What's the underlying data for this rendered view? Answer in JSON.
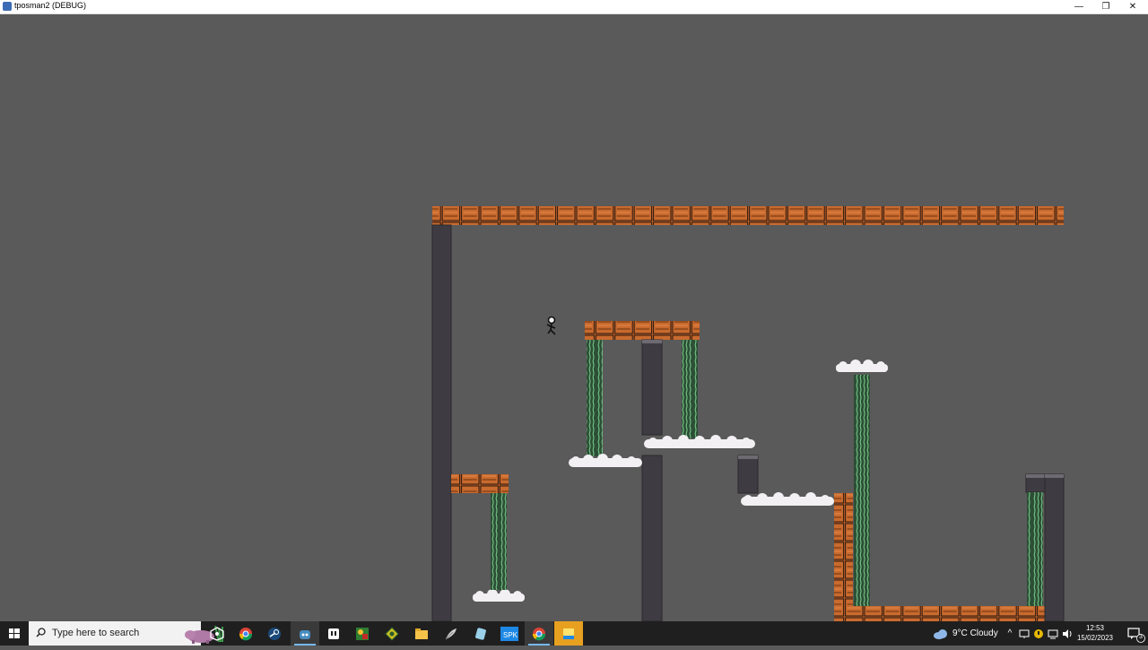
{
  "window": {
    "title": "tposman2 (DEBUG)",
    "minimize_glyph": "—",
    "maximize_glyph": "❐",
    "close_glyph": "✕"
  },
  "game": {
    "background_color": "#5a5a5a",
    "brick_color": "#c0642a",
    "pillar_color": "#3e3b42",
    "vine_color": "#3a6a45",
    "cloud_color": "#f2f0f3"
  },
  "taskbar": {
    "search_placeholder": "Type here to search",
    "pinned": [
      {
        "name": "task-view-icon",
        "active": false
      },
      {
        "name": "chrome-icon",
        "active": false
      },
      {
        "name": "steam-icon",
        "active": false
      },
      {
        "name": "godot-icon",
        "active": true
      },
      {
        "name": "notepad-icon",
        "active": false
      },
      {
        "name": "paint-icon",
        "active": false
      },
      {
        "name": "aseprite-icon",
        "active": false
      },
      {
        "name": "file-explorer-icon",
        "active": false
      },
      {
        "name": "feather-icon",
        "active": false
      },
      {
        "name": "scroll-icon",
        "active": false
      },
      {
        "name": "app-icon",
        "active": false
      },
      {
        "name": "chrome-alt-icon",
        "active": false
      },
      {
        "name": "sticky-note-icon",
        "active": false
      }
    ],
    "weather": {
      "temperature": "9°C",
      "condition": "Cloudy"
    },
    "tray_chevron": "^",
    "time": "12:53",
    "date": "15/02/2023",
    "notification_count": "3"
  }
}
